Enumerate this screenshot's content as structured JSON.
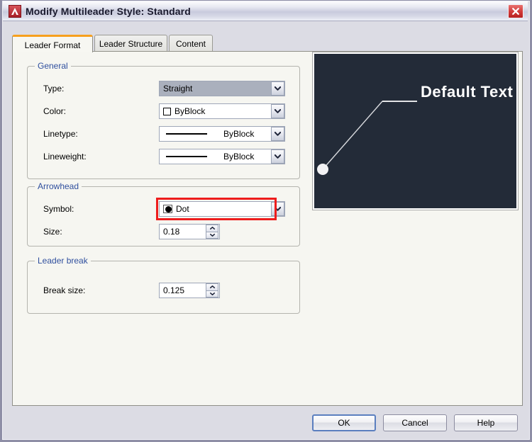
{
  "window": {
    "title": "Modify Multileader Style: Standard",
    "app_icon": "autocad-logo-icon",
    "close_label": "close-icon"
  },
  "tabs": [
    {
      "label": "Leader Format",
      "active": true
    },
    {
      "label": "Leader Structure",
      "active": false
    },
    {
      "label": "Content",
      "active": false
    }
  ],
  "groups": {
    "general": {
      "title": "General",
      "rows": [
        {
          "label": "Type:",
          "value": "Straight",
          "state": "selected"
        },
        {
          "label": "Color:",
          "value": "ByBlock",
          "state": "normal",
          "icon": "color-swatch-icon"
        },
        {
          "label": "Linetype:",
          "value": "ByBlock",
          "state": "normal",
          "icon": "solid-line-icon"
        },
        {
          "label": "Lineweight:",
          "value": "ByBlock",
          "state": "normal",
          "icon": "lineweight-line-icon"
        }
      ]
    },
    "arrowhead": {
      "title": "Arrowhead",
      "symbol_label": "Symbol:",
      "symbol_value": "Dot",
      "symbol_icon": "dot-arrowhead-icon",
      "size_label": "Size:",
      "size_value": "0.18",
      "highlight_color": "#ee1c1c"
    },
    "leader_break": {
      "title": "Leader break",
      "break_size_label": "Break size:",
      "break_size_value": "0.125"
    }
  },
  "preview": {
    "text": "Default Text",
    "background_color": "#232b38",
    "line_color": "#ffffff",
    "arrowhead": "dot"
  },
  "buttons": {
    "ok": "OK",
    "cancel": "Cancel",
    "help": "Help"
  }
}
